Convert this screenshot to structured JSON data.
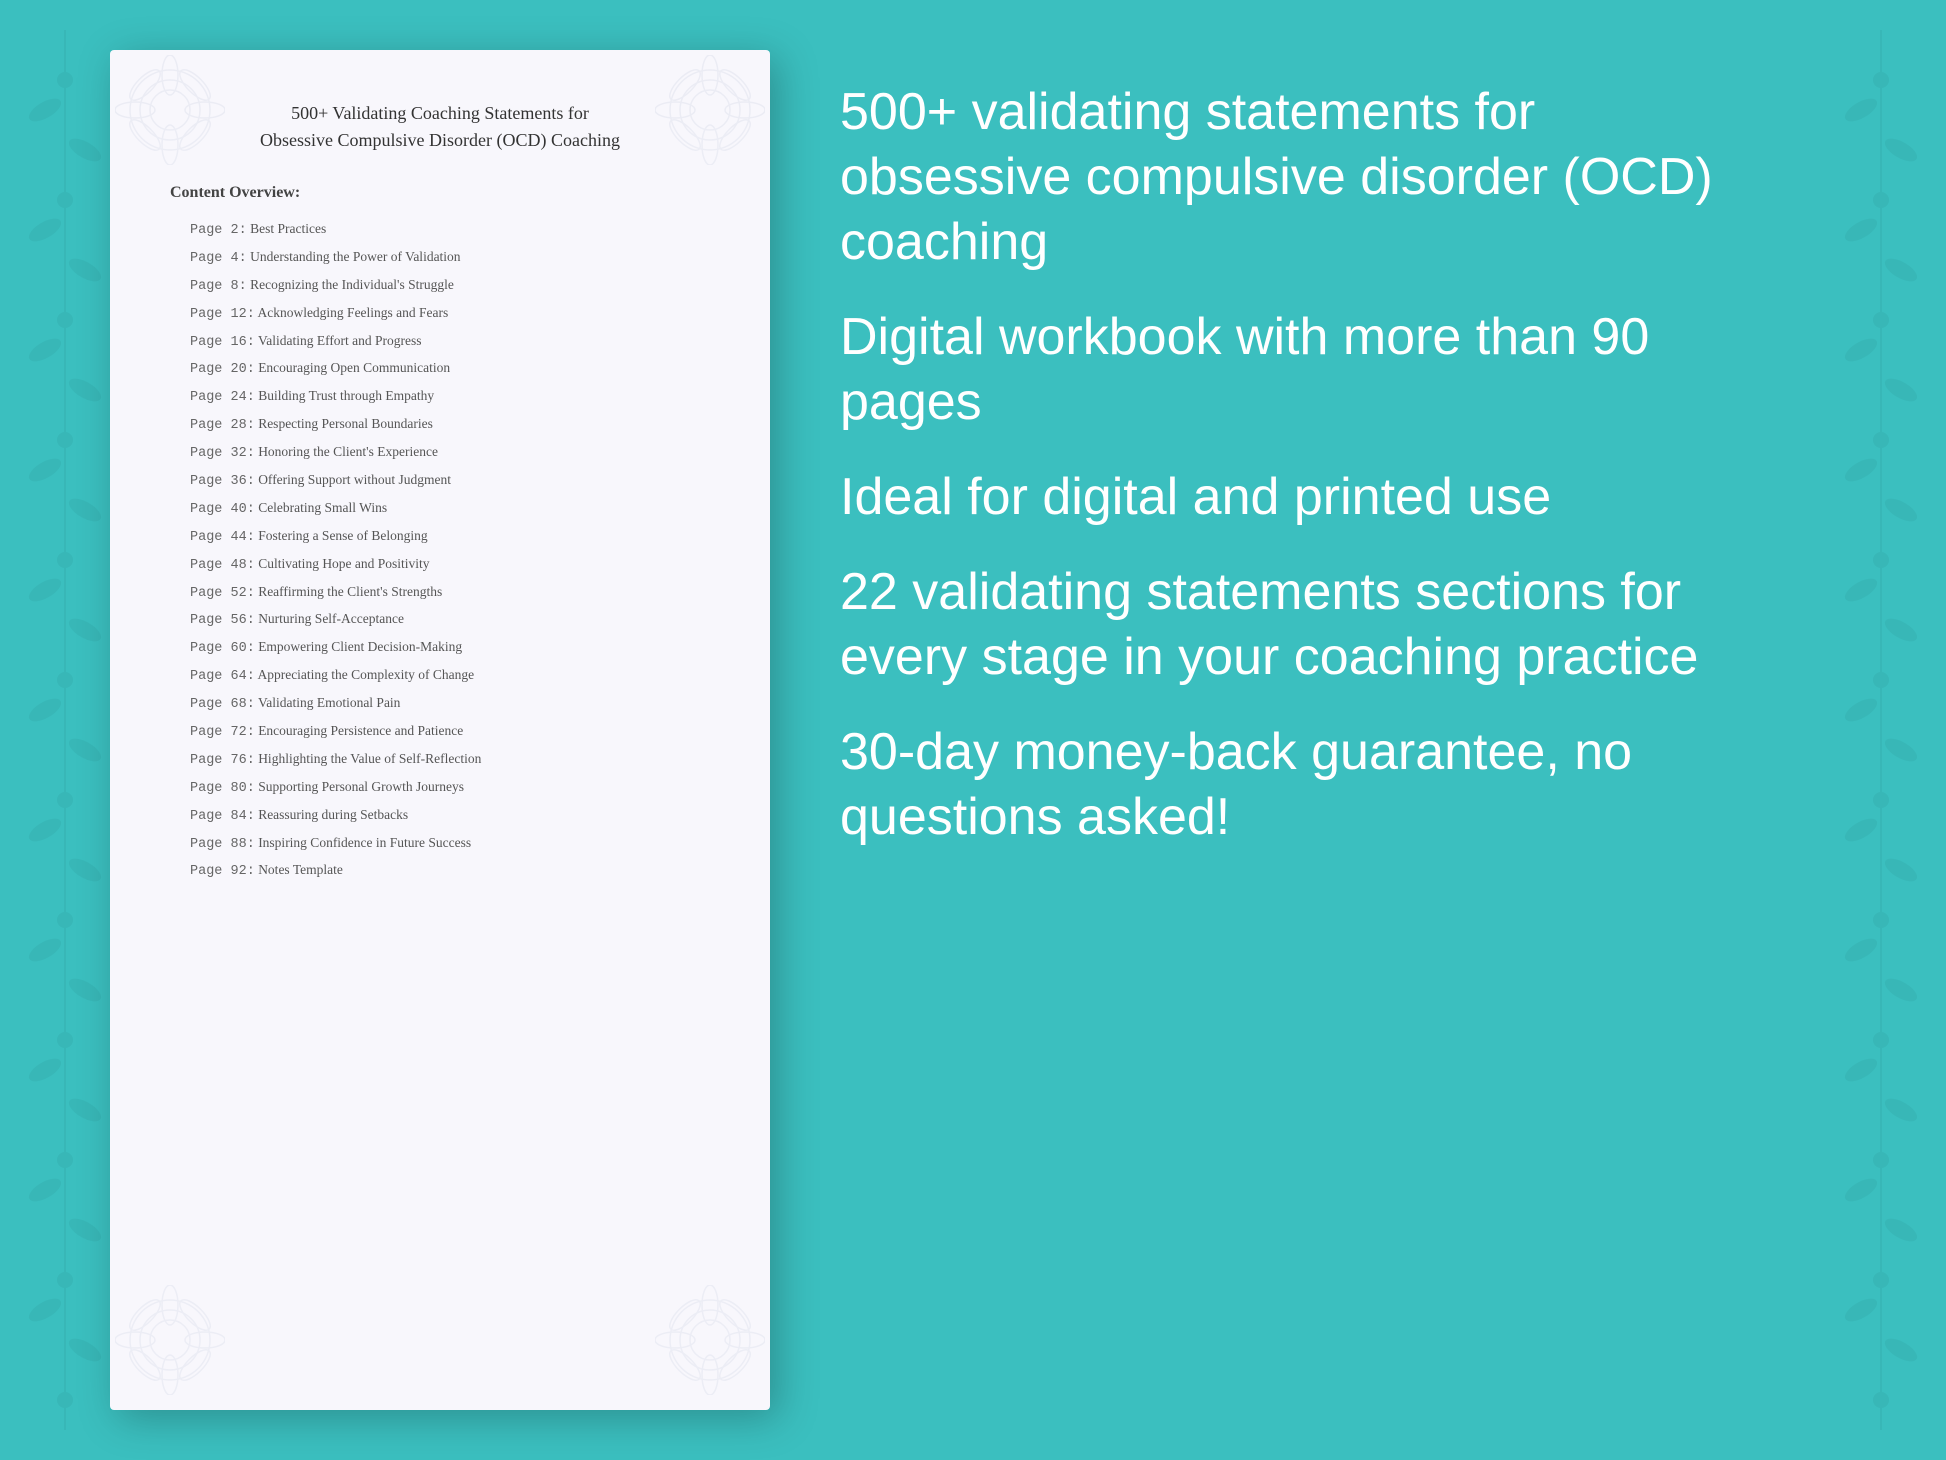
{
  "background_color": "#3bbfbf",
  "document": {
    "title_line1": "500+ Validating Coaching Statements for",
    "title_line2": "Obsessive Compulsive Disorder (OCD) Coaching",
    "content_label": "Content Overview:",
    "toc": [
      {
        "page": "Page  2:",
        "title": "Best Practices"
      },
      {
        "page": "Page  4:",
        "title": "Understanding the Power of Validation"
      },
      {
        "page": "Page  8:",
        "title": "Recognizing the Individual's Struggle"
      },
      {
        "page": "Page 12:",
        "title": "Acknowledging Feelings and Fears"
      },
      {
        "page": "Page 16:",
        "title": "Validating Effort and Progress"
      },
      {
        "page": "Page 20:",
        "title": "Encouraging Open Communication"
      },
      {
        "page": "Page 24:",
        "title": "Building Trust through Empathy"
      },
      {
        "page": "Page 28:",
        "title": "Respecting Personal Boundaries"
      },
      {
        "page": "Page 32:",
        "title": "Honoring the Client's Experience"
      },
      {
        "page": "Page 36:",
        "title": "Offering Support without Judgment"
      },
      {
        "page": "Page 40:",
        "title": "Celebrating Small Wins"
      },
      {
        "page": "Page 44:",
        "title": "Fostering a Sense of Belonging"
      },
      {
        "page": "Page 48:",
        "title": "Cultivating Hope and Positivity"
      },
      {
        "page": "Page 52:",
        "title": "Reaffirming the Client's Strengths"
      },
      {
        "page": "Page 56:",
        "title": "Nurturing Self-Acceptance"
      },
      {
        "page": "Page 60:",
        "title": "Empowering Client Decision-Making"
      },
      {
        "page": "Page 64:",
        "title": "Appreciating the Complexity of Change"
      },
      {
        "page": "Page 68:",
        "title": "Validating Emotional Pain"
      },
      {
        "page": "Page 72:",
        "title": "Encouraging Persistence and Patience"
      },
      {
        "page": "Page 76:",
        "title": "Highlighting the Value of Self-Reflection"
      },
      {
        "page": "Page 80:",
        "title": "Supporting Personal Growth Journeys"
      },
      {
        "page": "Page 84:",
        "title": "Reassuring during Setbacks"
      },
      {
        "page": "Page 88:",
        "title": "Inspiring Confidence in Future Success"
      },
      {
        "page": "Page 92:",
        "title": "Notes Template"
      }
    ]
  },
  "features": [
    {
      "id": "feature1",
      "text": "500+ validating statements for obsessive compulsive disorder (OCD) coaching"
    },
    {
      "id": "feature2",
      "text": "Digital workbook with more than 90 pages"
    },
    {
      "id": "feature3",
      "text": "Ideal for digital and printed use"
    },
    {
      "id": "feature4",
      "text": "22 validating statements sections for every stage in your coaching practice"
    },
    {
      "id": "feature5",
      "text": "30-day money-back guarantee, no questions asked!"
    }
  ]
}
